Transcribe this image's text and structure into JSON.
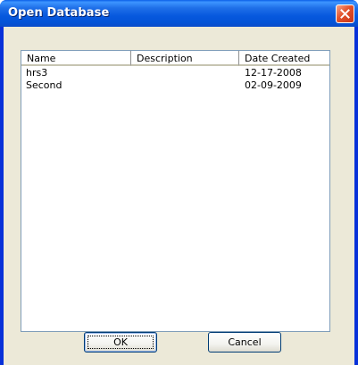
{
  "window": {
    "title": "Open Database"
  },
  "listview": {
    "columns": [
      "Name",
      "Description",
      "Date Created"
    ],
    "rows": [
      {
        "name": "hrs3",
        "description": "",
        "date_created": "12-17-2008"
      },
      {
        "name": "Second",
        "description": "",
        "date_created": "02-09-2009"
      }
    ]
  },
  "buttons": {
    "ok_label": "OK",
    "cancel_label": "Cancel"
  },
  "colors": {
    "titlebar": "#0658de",
    "client_background": "#ece9d8",
    "close_button": "#e2512a"
  },
  "icons": {
    "close": "close-icon"
  }
}
